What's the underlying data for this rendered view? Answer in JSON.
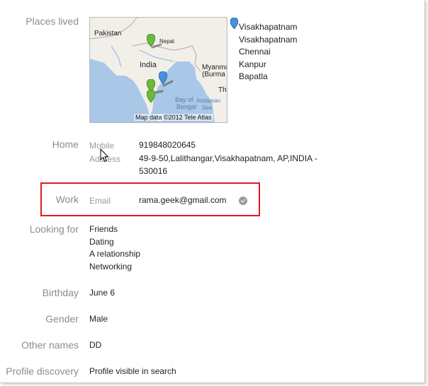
{
  "places_lived": {
    "label": "Places lived",
    "map": {
      "labels": {
        "pakistan": "Pakistan",
        "nepal": "Nepal",
        "india": "India",
        "myanmar": "Myanma",
        "burma": "(Burma",
        "bay": "Bay of",
        "bengal": "Bengal",
        "andaman": "Andaman",
        "sea": "Sea",
        "th": "Th",
        "credit": "Map data ©2012 Tele Atlas"
      },
      "colors": {
        "water": "#a9c7e6",
        "land": "#f2efe9",
        "green_pin": "#6bbb3b",
        "blue_pin": "#4a90e2"
      }
    },
    "places": [
      "Visakhapatnam",
      "Visakhapatnam",
      "Chennai",
      "Kanpur",
      "Bapatla"
    ]
  },
  "home": {
    "label": "Home",
    "mobile_label": "Mobile",
    "mobile_value": "919848020645",
    "address_label": "Address",
    "address_line1": "49-9-50,Lalithangar,Visakhapatnam, AP,INDIA -",
    "address_line2": "530016"
  },
  "work": {
    "label": "Work",
    "email_label": "Email",
    "email_value": "rama.geek@gmail.com",
    "highlight_color": "#e2181e"
  },
  "looking_for": {
    "label": "Looking for",
    "items": [
      "Friends",
      "Dating",
      "A relationship",
      "Networking"
    ]
  },
  "birthday": {
    "label": "Birthday",
    "value": "June 6"
  },
  "gender": {
    "label": "Gender",
    "value": "Male"
  },
  "other_names": {
    "label": "Other names",
    "value": "DD"
  },
  "profile_discovery": {
    "label": "Profile discovery",
    "value": "Profile visible in search"
  }
}
